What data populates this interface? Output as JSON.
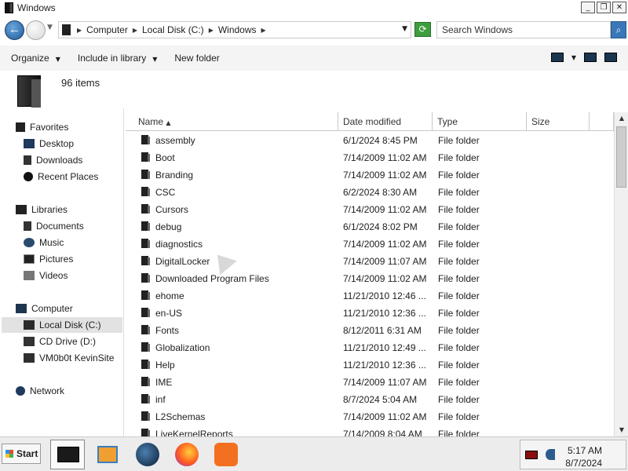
{
  "window": {
    "title": "Windows"
  },
  "window_buttons": {
    "minimize": "_",
    "maximize": "❐",
    "close": "✕"
  },
  "address": {
    "crumbs": [
      "Computer",
      "Local Disk (C:)",
      "Windows"
    ],
    "search_placeholder": "Search Windows"
  },
  "toolbar": {
    "organize": "Organize",
    "include": "Include in library",
    "new_folder": "New folder"
  },
  "details": {
    "count": "96 items"
  },
  "nav": {
    "favorites": "Favorites",
    "desktop": "Desktop",
    "downloads": "Downloads",
    "recent": "Recent Places",
    "libraries": "Libraries",
    "documents": "Documents",
    "music": "Music",
    "pictures": "Pictures",
    "videos": "Videos",
    "computer": "Computer",
    "local_disk": "Local Disk (C:)",
    "cd_drive": "CD Drive (D:)",
    "vm_share": "VM0b0t KevinSite",
    "network": "Network"
  },
  "columns": {
    "name": "Name",
    "date": "Date modified",
    "type": "Type",
    "size": "Size"
  },
  "files": [
    {
      "name": "assembly",
      "date": "6/1/2024 8:45 PM",
      "type": "File folder"
    },
    {
      "name": "Boot",
      "date": "7/14/2009 11:02 AM",
      "type": "File folder"
    },
    {
      "name": "Branding",
      "date": "7/14/2009 11:02 AM",
      "type": "File folder"
    },
    {
      "name": "CSC",
      "date": "6/2/2024 8:30 AM",
      "type": "File folder"
    },
    {
      "name": "Cursors",
      "date": "7/14/2009 11:02 AM",
      "type": "File folder"
    },
    {
      "name": "debug",
      "date": "6/1/2024 8:02 PM",
      "type": "File folder"
    },
    {
      "name": "diagnostics",
      "date": "7/14/2009 11:02 AM",
      "type": "File folder"
    },
    {
      "name": "DigitalLocker",
      "date": "7/14/2009 11:07 AM",
      "type": "File folder"
    },
    {
      "name": "Downloaded Program Files",
      "date": "7/14/2009 11:02 AM",
      "type": "File folder"
    },
    {
      "name": "ehome",
      "date": "11/21/2010 12:46 ...",
      "type": "File folder"
    },
    {
      "name": "en-US",
      "date": "11/21/2010 12:36 ...",
      "type": "File folder"
    },
    {
      "name": "Fonts",
      "date": "8/12/2011 6:31 AM",
      "type": "File folder"
    },
    {
      "name": "Globalization",
      "date": "11/21/2010 12:49 ...",
      "type": "File folder"
    },
    {
      "name": "Help",
      "date": "11/21/2010 12:36 ...",
      "type": "File folder"
    },
    {
      "name": "IME",
      "date": "7/14/2009 11:07 AM",
      "type": "File folder"
    },
    {
      "name": "inf",
      "date": "8/7/2024 5:04 AM",
      "type": "File folder"
    },
    {
      "name": "L2Schemas",
      "date": "7/14/2009 11:02 AM",
      "type": "File folder"
    },
    {
      "name": "LiveKernelReports",
      "date": "7/14/2009 8:04 AM",
      "type": "File folder"
    }
  ],
  "taskbar": {
    "start": "Start",
    "time": "5:17 AM",
    "date": "8/7/2024"
  }
}
